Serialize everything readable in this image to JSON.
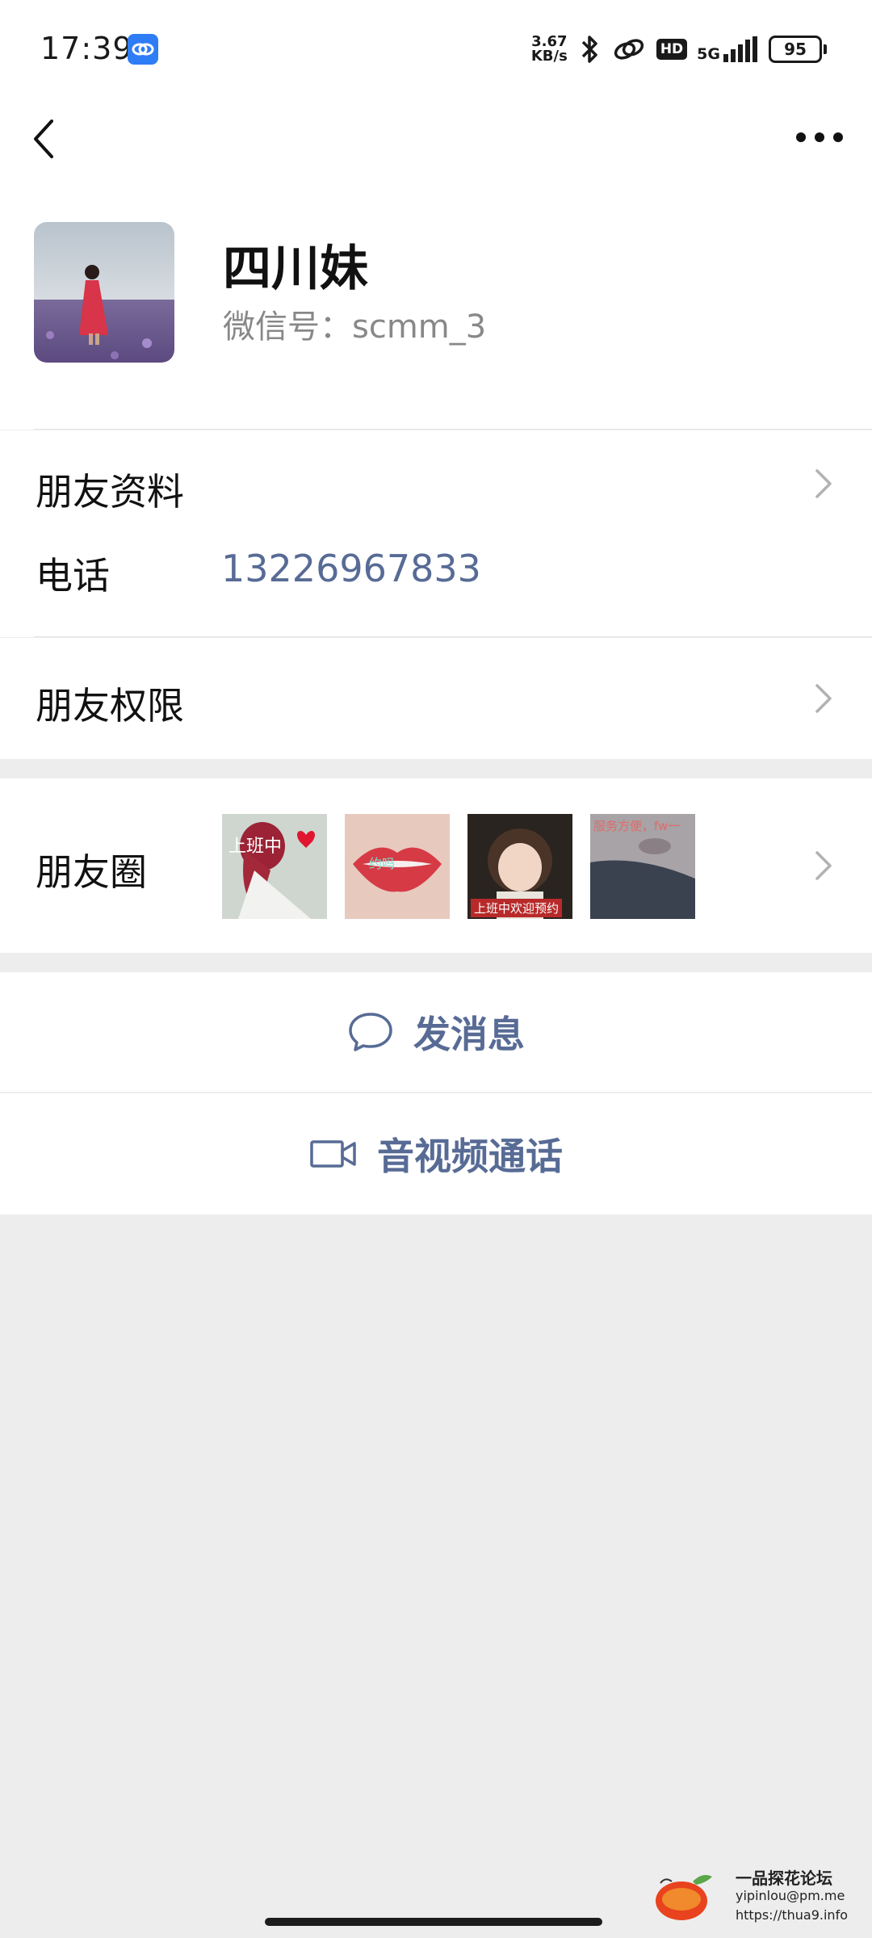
{
  "status_bar": {
    "time": "17:39",
    "net_speed_value": "3.67",
    "net_speed_unit": "KB/s",
    "hd": "HD",
    "network": "5G",
    "battery": "95",
    "icons": [
      "app-link-icon",
      "bluetooth-icon",
      "link-icon",
      "signal-icon",
      "battery-icon"
    ]
  },
  "nav": {
    "back_icon": "chevron-left-icon",
    "more_icon": "more-dots-icon"
  },
  "profile": {
    "nickname": "四川妹",
    "wechat_id": "微信号：scmm_3"
  },
  "rows": {
    "friend_profile": "朋友资料",
    "phone_label": "电话",
    "phone_value": "13226967833",
    "friend_permissions": "朋友权限",
    "moments": "朋友圈"
  },
  "moments_thumbs": [
    {
      "caption": "上班中"
    },
    {
      "caption": "约吗"
    },
    {
      "caption": "上班中欢迎预约"
    },
    {
      "caption": "服务方便，fw一"
    }
  ],
  "actions": {
    "send_message": "发消息",
    "av_call": "音视频通话"
  },
  "watermark": {
    "title": "一品探花论坛",
    "email": "yipinlou@pm.me",
    "url": "https://thua9.info"
  },
  "colors": {
    "link": "#576b95",
    "background": "#ededed"
  }
}
